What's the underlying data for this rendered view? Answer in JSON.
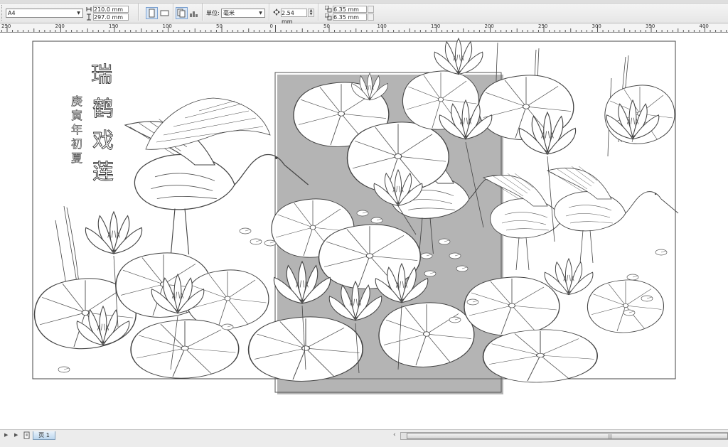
{
  "propertybar": {
    "paper_size": "A4",
    "width_value": "210.0 mm",
    "height_value": "297.0 mm",
    "units_label": "单位:",
    "units_value": "毫米",
    "nudge_value": "2.54 mm",
    "dup_x_value": "6.35 mm",
    "dup_y_value": "6.35 mm"
  },
  "ruler": {
    "labels": [
      "250",
      "200",
      "150",
      "100",
      "50",
      "0",
      "50",
      "100",
      "150",
      "200",
      "250",
      "300",
      "350",
      "400"
    ]
  },
  "artwork": {
    "title_chars": [
      "瑞",
      "鹤",
      "戏",
      "莲"
    ],
    "inscription_chars": [
      "庚",
      "寅",
      "年",
      "初",
      "夏"
    ]
  },
  "statusbar": {
    "page_tab_label": "页 1"
  },
  "colors": {
    "toolbar_bg": "#e9e9e9",
    "canvas_bg": "#ffffff",
    "line_art": "#444444",
    "page_tab": "#c6dcf0"
  }
}
